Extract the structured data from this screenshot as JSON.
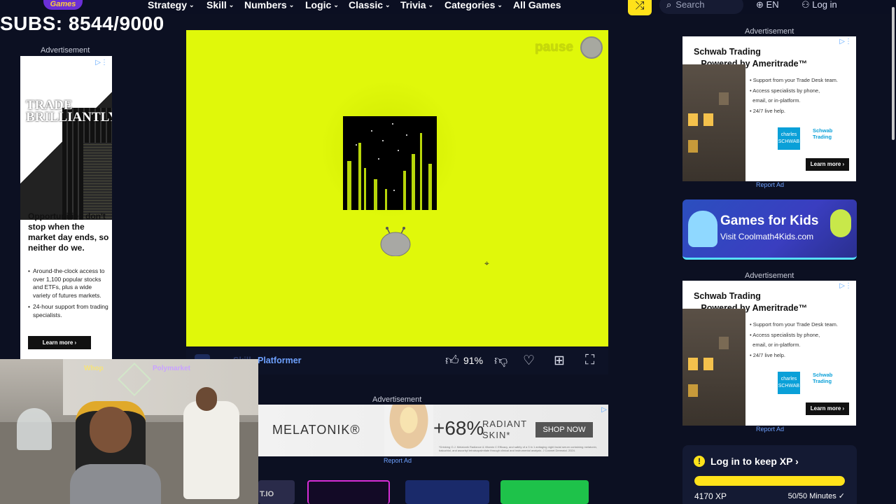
{
  "nav": {
    "logo": "Games",
    "items": [
      {
        "label": "Strategy",
        "chev": true
      },
      {
        "label": "Skill",
        "chev": true
      },
      {
        "label": "Numbers",
        "chev": true
      },
      {
        "label": "Logic",
        "chev": true
      },
      {
        "label": "Classic",
        "chev": true
      },
      {
        "label": "Trivia",
        "chev": true
      },
      {
        "label": "Categories",
        "chev": true
      },
      {
        "label": "All Games",
        "chev": false
      }
    ],
    "search_placeholder": "Search",
    "language": "EN",
    "login": "Log in"
  },
  "overlay": {
    "subs": "SUBS: 8544/9000"
  },
  "left_ad": {
    "label": "Advertisement",
    "hero": "TRADE BRILLIANTLY",
    "headline": "Opportunities don't stop when the market day ends, so neither do we.",
    "bullets": [
      "Around-the-clock access to over 1,100 popular stocks and ETFs, plus a wide variety of futures markets.",
      "24-hour support from trading specialists."
    ],
    "cta": "Learn more ›"
  },
  "game": {
    "pause_label": "pause",
    "title": "Platformer",
    "title_prefix": "Skill",
    "rating": "91%"
  },
  "webcam": {
    "neon_left": "Whop",
    "neon_right": "Polymarket"
  },
  "mid_ad": {
    "label": "Advertisement",
    "brand": "MELATONIK®",
    "stat": "+68%",
    "claim_line1": "RADIANT",
    "claim_line2": "SKIN*",
    "cta": "SHOP NOW",
    "report": "Report Ad",
    "fine_print": "*Drinking O.J. Melatonik Radiance & Vitamin C Efficacy, and safety of a 3 in 1 antiaging night facial serum containing melatonin, bakuchiol, and ascorbyl tetraisopalmitate through clinical and instrumental analysis. J Cosmet Dermatol. 2024."
  },
  "thumb_row": {
    "first_label": "T.IO"
  },
  "right_ads": [
    {
      "label": "Advertisement",
      "headline_line1": "Schwab Trading",
      "headline_line2": "Powered by Ameritrade™",
      "bullets": [
        "• Support from your Trade Desk team.",
        "• Access specialists by phone,",
        "email, or in-platform.",
        "• 24/7 live help."
      ],
      "logo1": "charles SCHWAB",
      "logo2_line1": "Schwab",
      "logo2_line2": "Trading",
      "cta": "Learn more ›",
      "report": "Report Ad"
    },
    {
      "label": "Advertisement",
      "headline_line1": "Schwab Trading",
      "headline_line2": "Powered by Ameritrade™",
      "bullets": [
        "• Support from your Trade Desk team.",
        "• Access specialists by phone,",
        "email, or in-platform.",
        "• 24/7 live help."
      ],
      "logo1": "charles SCHWAB",
      "logo2_line1": "Schwab",
      "logo2_line2": "Trading",
      "cta": "Learn more ›",
      "report": "Report Ad"
    }
  ],
  "kids_banner": {
    "title": "Games for Kids",
    "subtitle": "Visit Coolmath4Kids.com"
  },
  "xp_card": {
    "title": "Log in to keep XP",
    "chevron": "›",
    "xp": "4170 XP",
    "minutes": "50/50 Minutes ✓",
    "progress": 1.0
  },
  "colors": {
    "game_bg": "#e0f80a",
    "accent_yellow": "#ffe21a",
    "link_blue": "#6ea1ff"
  }
}
